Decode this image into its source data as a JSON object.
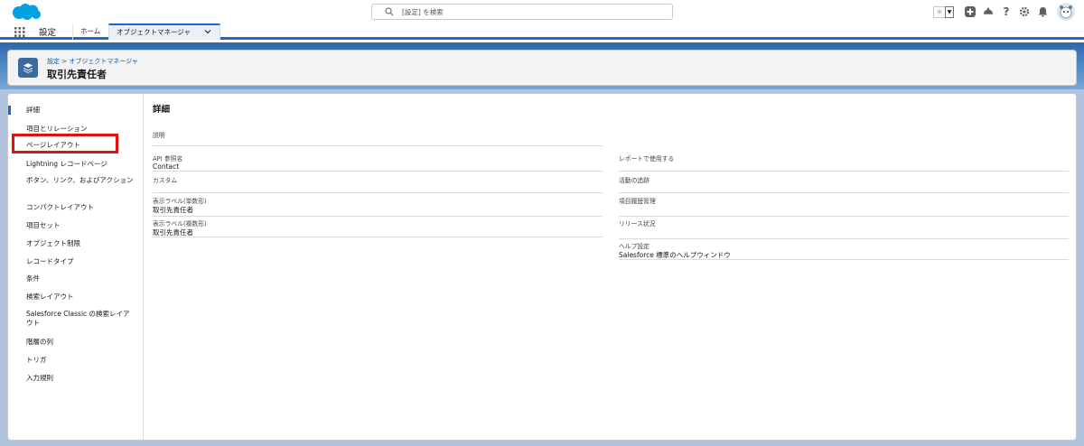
{
  "global_header": {
    "search_placeholder": "[設定] を検索"
  },
  "context_bar": {
    "app_name": "設定",
    "tabs": [
      {
        "label": "ホーム"
      },
      {
        "label": "オブジェクトマネージャ"
      }
    ]
  },
  "page_header": {
    "breadcrumb": [
      "設定",
      "オブジェクトマネージャ"
    ],
    "breadcrumb_separator": ">",
    "title": "取引先責任者"
  },
  "sidebar": {
    "items": [
      {
        "label": "詳細",
        "active": true
      },
      {
        "label": "項目とリレーション"
      },
      {
        "label": "ページレイアウト"
      },
      {
        "label": "Lightning レコードページ"
      },
      {
        "label": "ボタン、リンク、およびアクション"
      },
      {
        "label": "コンパクトレイアウト"
      },
      {
        "label": "項目セット"
      },
      {
        "label": "オブジェクト制限"
      },
      {
        "label": "レコードタイプ"
      },
      {
        "label": "条件"
      },
      {
        "label": "検索レイアウト"
      },
      {
        "label": "Salesforce Classic の検索レイアウト"
      },
      {
        "label": "階層の列"
      },
      {
        "label": "トリガ"
      },
      {
        "label": "入力規則"
      }
    ]
  },
  "details": {
    "section_title": "詳細",
    "left_fields": [
      {
        "label": "説明",
        "value": ""
      },
      {
        "label": "API 参照名",
        "value": "Contact"
      },
      {
        "label": "カスタム",
        "value": ""
      },
      {
        "label": "表示ラベル(単数形)",
        "value": "取引先責任者"
      },
      {
        "label": "表示ラベル(複数形)",
        "value": "取引先責任者"
      }
    ],
    "right_fields": [
      {
        "label": "レポートで使用する",
        "value": ""
      },
      {
        "label": "活動の追跡",
        "value": ""
      },
      {
        "label": "項目履歴管理",
        "value": ""
      },
      {
        "label": "リリース状況",
        "value": ""
      },
      {
        "label": "ヘルプ設定",
        "value": "Salesforce 標準のヘルプウィンドウ"
      }
    ]
  },
  "colors": {
    "brand_blue": "#1b6ac9",
    "highlight_red": "#e01010",
    "object_icon": "#3a6a9e"
  },
  "icons": [
    "salesforce-logo-icon",
    "search-icon",
    "favorite-star-icon",
    "favorites-dropdown-icon",
    "add-icon",
    "trailhead-icon",
    "help-icon",
    "setup-gear-icon",
    "notification-bell-icon",
    "avatar",
    "app-launcher-icon",
    "chevron-down-icon",
    "object-stack-icon"
  ]
}
